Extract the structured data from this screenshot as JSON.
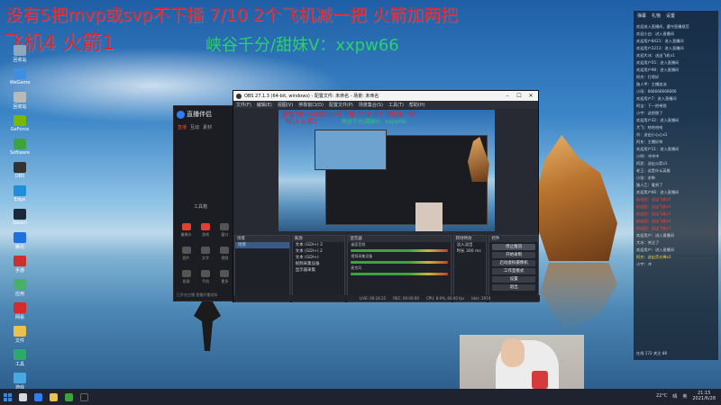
{
  "overlay": {
    "line1": "没有5把mvp或svp不下播 7/10 2个飞机减一把 火箭加两把",
    "line2": "飞机4 火箭1",
    "line3": "峡谷千分/甜妹V：xxpw66"
  },
  "desktop_icons": [
    {
      "label": "回收站",
      "color": "#8fa6bf"
    },
    {
      "label": "WeGame",
      "color": "#3f8fe0"
    },
    {
      "label": "回收站",
      "color": "#b9b9b9"
    },
    {
      "label": "GeForce",
      "color": "#76b900"
    },
    {
      "label": "Software",
      "color": "#3ea33e"
    },
    {
      "label": "OBS",
      "color": "#333"
    },
    {
      "label": "Edge",
      "color": "#1f8fd6"
    },
    {
      "label": "Steam",
      "color": "#1b2838"
    },
    {
      "label": "腾讯",
      "color": "#1e6fe0"
    },
    {
      "label": "手游",
      "color": "#cc2f2f"
    },
    {
      "label": "应用",
      "color": "#49b06b"
    },
    {
      "label": "网易",
      "color": "#d42b2b"
    },
    {
      "label": "文件",
      "color": "#e9c14c"
    },
    {
      "label": "工具",
      "color": "#2faa6a"
    },
    {
      "label": "游戏",
      "color": "#4aa7e0"
    },
    {
      "label": "设置",
      "color": "#e07a2f"
    }
  ],
  "launcher": {
    "brand": "直播伴侣",
    "tabs": [
      "直播",
      "互动",
      "素材"
    ],
    "active_tab": "直播",
    "mid_label": "工具箱",
    "tools": [
      "摄像头",
      "游戏",
      "窗口",
      "图片",
      "文字",
      "视频",
      "投屏",
      "手机",
      "更多"
    ],
    "footer": "已开启主播  直播开播须知"
  },
  "obs": {
    "title": "OBS 27.1.3 (64-bit, windows) - 配置文件: 未命名 - 场景: 未命名",
    "menu": [
      "文件(F)",
      "编辑(E)",
      "视图(V)",
      "停靠窗口(D)",
      "配置文件(P)",
      "场景集合(S)",
      "工具(T)",
      "帮助(H)"
    ],
    "preview": {
      "line1": "没有5把mvp或svp不下播 7/10 2个飞机减一把",
      "line2": "飞机4 火箭1",
      "line3": "峡谷千分/甜妹V：xxpw66"
    },
    "docks": {
      "scenes": {
        "title": "场景",
        "items": [
          "场景"
        ]
      },
      "sources": {
        "title": "来源",
        "items": [
          "文本 (GDI+) 3",
          "文本 (GDI+) 2",
          "文本 (GDI+)",
          "视频采集设备",
          "显示器采集"
        ]
      },
      "mixer": {
        "title": "混音器",
        "channels": [
          "桌面音频",
          "视频采集设备",
          "麦克风"
        ]
      },
      "transitions": {
        "title": "转场特效",
        "items": [
          "淡入淡出",
          "时长 300 ms"
        ]
      },
      "controls": {
        "title": "控件",
        "buttons": [
          "停止推流",
          "开始录制",
          "启动虚拟摄像机",
          "工作室模式",
          "设置",
          "退出"
        ]
      }
    },
    "status": [
      "LIVE: 00:24:22",
      "REC: 00:00:00",
      "CPU: 8.9%, 60.00 fps",
      "kb/s: 2974"
    ]
  },
  "chat": {
    "tabs": [
      "弹幕",
      "礼物",
      "设置"
    ],
    "messages": [
      {
        "text": "欢迎进入直播间，遵守直播规范",
        "style": "normal"
      },
      {
        "text": "欢迎小白：进入直播间",
        "style": "normal"
      },
      {
        "text": "欢迎用户8421：进入直播间",
        "style": "normal"
      },
      {
        "text": "欢迎用户2213：进入直播间",
        "style": "normal"
      },
      {
        "text": "欢迎大冰：送出飞机x1",
        "style": "normal"
      },
      {
        "text": "欢迎用户55：进入直播间",
        "style": "normal"
      },
      {
        "text": "欢迎用户98：进入直播间",
        "style": "normal"
      },
      {
        "text": "阿杰：打得好",
        "style": "normal"
      },
      {
        "text": "路人甲：主播加油",
        "style": "normal"
      },
      {
        "text": "小雨：666666666666",
        "style": "normal"
      },
      {
        "text": "欢迎用户7：进入直播间",
        "style": "normal"
      },
      {
        "text": "阿宝：下一把带我",
        "style": "normal"
      },
      {
        "text": "小宇：这把稳了",
        "style": "normal"
      },
      {
        "text": "欢迎用户32：进入直播间",
        "style": "normal"
      },
      {
        "text": "大飞：哈哈哈哈",
        "style": "normal"
      },
      {
        "text": "刘：送出小心心x1",
        "style": "normal"
      },
      {
        "text": "阿东：主播好帅",
        "style": "normal"
      },
      {
        "text": "欢迎用户11：进入直播间",
        "style": "normal"
      },
      {
        "text": "小明：冲冲冲",
        "style": "normal"
      },
      {
        "text": "阿凯：送出火箭x1",
        "style": "normal"
      },
      {
        "text": "老王：这是什么英雄",
        "style": "normal"
      },
      {
        "text": "小张：求带",
        "style": "normal"
      },
      {
        "text": "路人乙：看到了",
        "style": "normal"
      },
      {
        "text": "欢迎用户66：进入直播间",
        "style": "normal"
      },
      {
        "text": "粉丝团：送出飞机x1",
        "style": "red"
      },
      {
        "text": "粉丝团：送出飞机x1",
        "style": "red"
      },
      {
        "text": "粉丝团：送出飞机x1",
        "style": "red"
      },
      {
        "text": "粉丝团：送出飞机x1",
        "style": "red"
      },
      {
        "text": "粉丝团：送出飞机x1",
        "style": "red"
      },
      {
        "text": "欢迎用户：进入直播间",
        "style": "normal"
      },
      {
        "text": "大冰：关注了",
        "style": "normal"
      },
      {
        "text": "欢迎用户：进入直播间",
        "style": "normal"
      },
      {
        "text": "阿杰：送出荧光棒x1",
        "style": "yellow"
      },
      {
        "text": "小宇：冲",
        "style": "normal"
      }
    ],
    "footer": "在线 172  关注 88"
  },
  "taskbar": {
    "temperature": "22°C",
    "weather": "晴",
    "language": "英",
    "time": "21:15",
    "date": "2021/6/28"
  },
  "colors": {
    "overlay_red": "#e0242a",
    "overlay_green": "#2bd16a",
    "obs_bg": "#272a33",
    "taskbar": "#1f2330"
  }
}
